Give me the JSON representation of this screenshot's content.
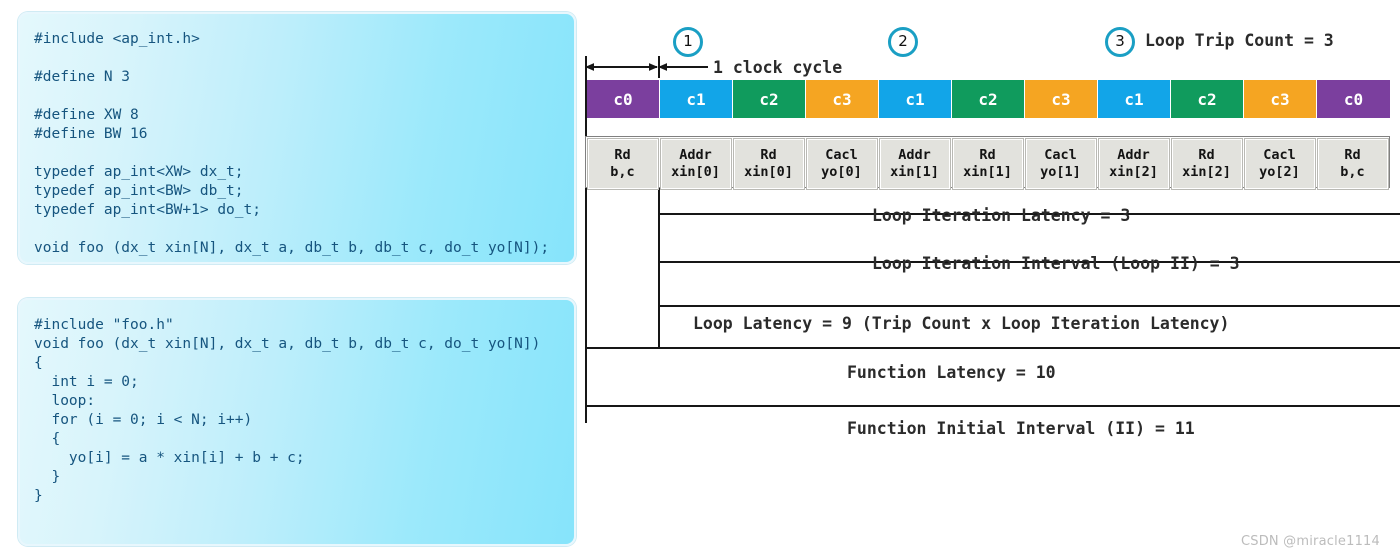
{
  "code_panels": [
    {
      "name": "header-file",
      "lines": [
        "#include <ap_int.h>",
        "",
        "#define N 3",
        "",
        "#define XW 8",
        "#define BW 16",
        "",
        "typedef ap_int<XW> dx_t;",
        "typedef ap_int<BW> db_t;",
        "typedef ap_int<BW+1> do_t;",
        "",
        "void foo (dx_t xin[N], dx_t a, db_t b, db_t c, do_t yo[N]);"
      ]
    },
    {
      "name": "source-file",
      "lines": [
        "#include \"foo.h\"",
        "void foo (dx_t xin[N], dx_t a, db_t b, db_t c, do_t yo[N])",
        "{",
        "  int i = 0;",
        "  loop:",
        "  for (i = 0; i < N; i++)",
        "  {",
        "    yo[i] = a * xin[i] + b + c;",
        "  }",
        "}"
      ]
    }
  ],
  "diagram": {
    "step_markers": [
      "1",
      "2",
      "3"
    ],
    "trip_count_label": "Loop Trip Count = 3",
    "clock_cycle_label": "1 clock cycle",
    "watermark": "CSDN @miracle1114",
    "colors": {
      "c0": "#7B3F9E",
      "c1": "#12A5E8",
      "c2": "#109B5D",
      "c3": "#F5A522",
      "marker_ring": "#1a9fc4",
      "cell_fill": "#e2e2dd",
      "line": "#161616"
    },
    "cycle_bar": [
      {
        "label": "c0",
        "state": "c0"
      },
      {
        "label": "c1",
        "state": "c1"
      },
      {
        "label": "c2",
        "state": "c2"
      },
      {
        "label": "c3",
        "state": "c3"
      },
      {
        "label": "c1",
        "state": "c1"
      },
      {
        "label": "c2",
        "state": "c2"
      },
      {
        "label": "c3",
        "state": "c3"
      },
      {
        "label": "c1",
        "state": "c1"
      },
      {
        "label": "c2",
        "state": "c2"
      },
      {
        "label": "c3",
        "state": "c3"
      },
      {
        "label": "c0",
        "state": "c0"
      }
    ],
    "op_table": [
      {
        "line1": "Rd",
        "line2": "b,c"
      },
      {
        "line1": "Addr",
        "line2": "xin[0]"
      },
      {
        "line1": "Rd",
        "line2": "xin[0]"
      },
      {
        "line1": "Cacl",
        "line2": "yo[0]"
      },
      {
        "line1": "Addr",
        "line2": "xin[1]"
      },
      {
        "line1": "Rd",
        "line2": "xin[1]"
      },
      {
        "line1": "Cacl",
        "line2": "yo[1]"
      },
      {
        "line1": "Addr",
        "line2": "xin[2]"
      },
      {
        "line1": "Rd",
        "line2": "xin[2]"
      },
      {
        "line1": "Cacl",
        "line2": "yo[2]"
      },
      {
        "line1": "Rd",
        "line2": "b,c"
      }
    ],
    "measures": {
      "loop_iteration_latency": "Loop Iteration Latency = 3",
      "loop_iteration_interval": "Loop Iteration Interval (Loop II) = 3",
      "loop_latency": "Loop Latency = 9 (Trip Count x Loop Iteration Latency)",
      "function_latency": "Function Latency = 10",
      "function_initial_interval": "Function Initial Interval (II) = 11"
    }
  },
  "chart_data": {
    "type": "table",
    "title": "HLS pipeline timing diagram",
    "categories": [
      "c0",
      "c1",
      "c2",
      "c3",
      "c1",
      "c2",
      "c3",
      "c1",
      "c2",
      "c3",
      "c0"
    ],
    "operations": [
      "Rd b,c",
      "Addr xin[0]",
      "Rd xin[0]",
      "Cacl yo[0]",
      "Addr xin[1]",
      "Rd xin[1]",
      "Cacl yo[1]",
      "Addr xin[2]",
      "Rd xin[2]",
      "Cacl yo[2]",
      "Rd b,c"
    ],
    "metrics": {
      "loop_trip_count": 3,
      "loop_iteration_latency": 3,
      "loop_iteration_interval": 3,
      "loop_latency": 9,
      "function_latency": 10,
      "function_initial_interval": 11,
      "clock_cycles_shown": 11
    }
  }
}
